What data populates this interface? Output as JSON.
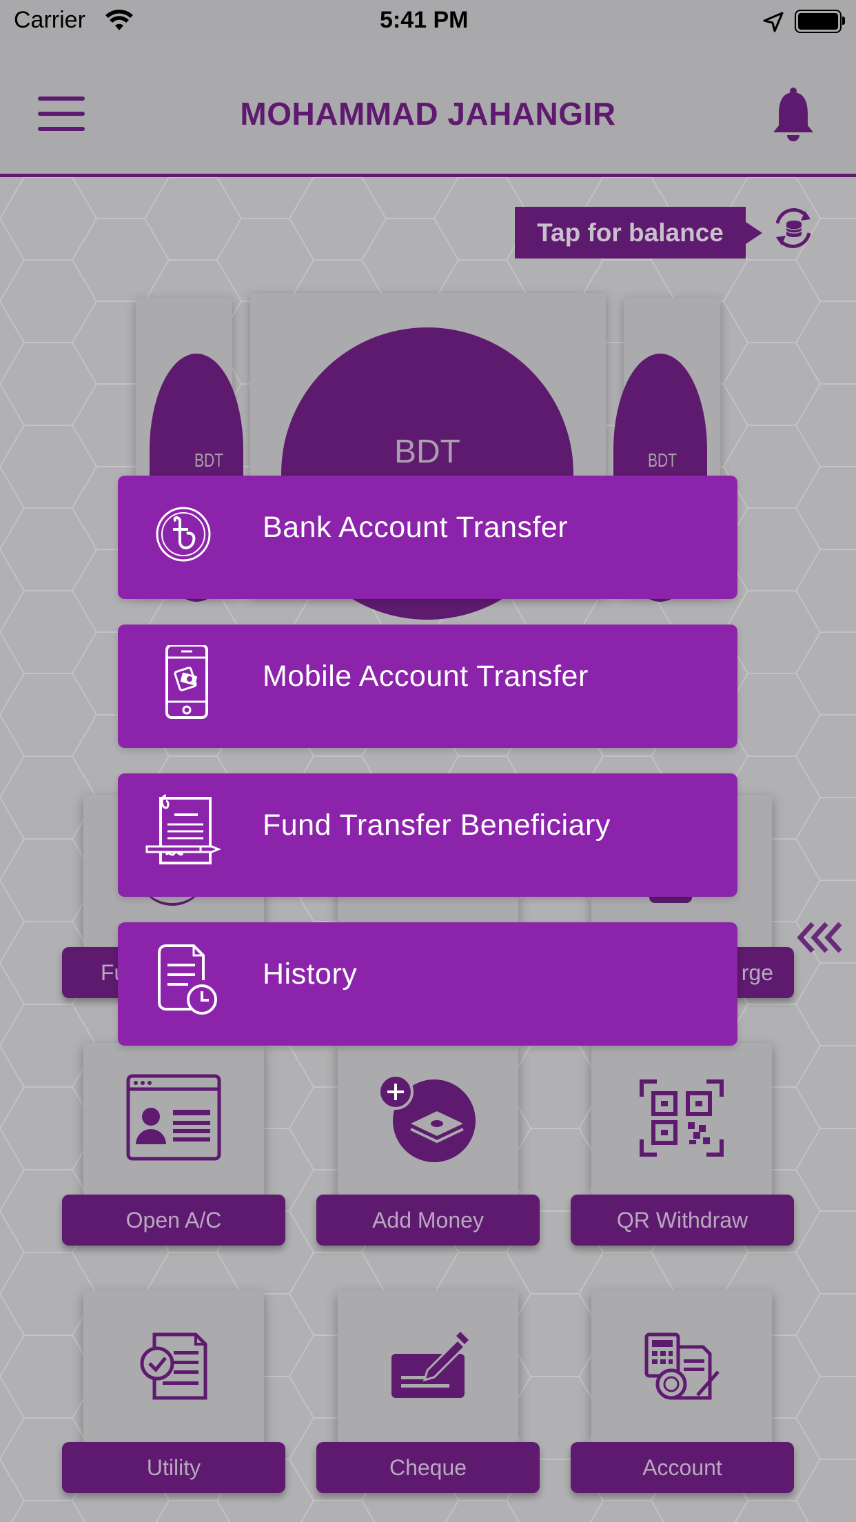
{
  "status_bar": {
    "carrier": "Carrier",
    "time": "5:41 PM"
  },
  "header": {
    "title": "MOHAMMAD JAHANGIR"
  },
  "balance": {
    "tap_label": "Tap for balance",
    "currency_main": "BDT",
    "currency_side": "BDT"
  },
  "popup_menu": {
    "items": [
      {
        "label": "Bank Account Transfer",
        "icon": "taka-coin-icon"
      },
      {
        "label": "Mobile Account Transfer",
        "icon": "mobile-transfer-icon"
      },
      {
        "label": "Fund Transfer Beneficiary",
        "icon": "cheque-document-icon"
      },
      {
        "label": "History",
        "icon": "history-document-icon"
      }
    ]
  },
  "tiles_row2_partial": {
    "left": "Fu",
    "right": "rge"
  },
  "tiles": [
    {
      "label": "Open A/C",
      "icon": "id-card-icon"
    },
    {
      "label": "Add Money",
      "icon": "add-money-icon"
    },
    {
      "label": "QR Withdraw",
      "icon": "qr-code-icon"
    },
    {
      "label": "Utility",
      "icon": "utility-bill-icon"
    },
    {
      "label": "Cheque",
      "icon": "cheque-icon"
    },
    {
      "label": "Account",
      "icon": "account-statement-icon"
    }
  ],
  "colors": {
    "primary": "#5e1a6e",
    "popup": "#8c24ab",
    "overlay": "#aaaaac"
  }
}
